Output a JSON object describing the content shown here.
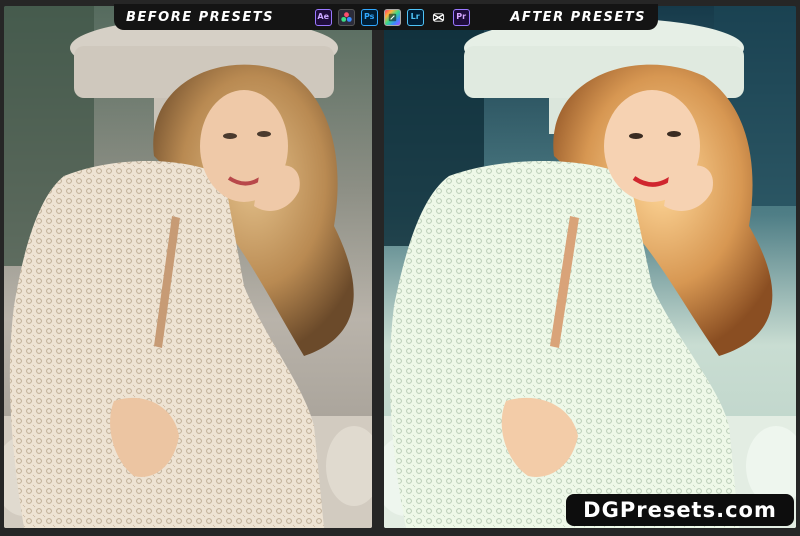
{
  "header": {
    "before_label": "BEFORE PRESETS",
    "after_label": "AFTER PRESETS",
    "apps": [
      {
        "name": "after-effects-icon",
        "label": "Ae"
      },
      {
        "name": "davinci-resolve-icon",
        "label": ""
      },
      {
        "name": "photoshop-icon",
        "label": "Ps"
      },
      {
        "name": "final-cut-pro-icon",
        "label": ""
      },
      {
        "name": "lightroom-icon",
        "label": "Lr"
      },
      {
        "name": "capcut-icon",
        "label": ""
      },
      {
        "name": "premiere-pro-icon",
        "label": "Pr"
      }
    ]
  },
  "brand": {
    "text": "DGPresets.com"
  },
  "colors": {
    "background": "#262626",
    "bar": "#141414",
    "before_tone": "#d9c9b3",
    "after_tone": "#dff0df",
    "after_shadow": "#163a4a"
  }
}
